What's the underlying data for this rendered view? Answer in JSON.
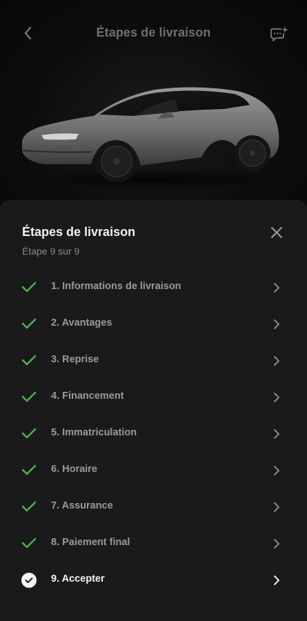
{
  "header": {
    "title": "Étapes de livraison"
  },
  "sheet": {
    "title": "Étapes de livraison",
    "subtitle": "Étape 9 sur 9"
  },
  "steps": [
    {
      "label": "1. Informations de livraison",
      "status": "complete"
    },
    {
      "label": "2. Avantages",
      "status": "complete"
    },
    {
      "label": "3. Reprise",
      "status": "complete"
    },
    {
      "label": "4. Financement",
      "status": "complete"
    },
    {
      "label": "5. Immatriculation",
      "status": "complete"
    },
    {
      "label": "6. Horaire",
      "status": "complete"
    },
    {
      "label": "7. Assurance",
      "status": "complete"
    },
    {
      "label": "8. Paiement final",
      "status": "complete"
    },
    {
      "label": "9. Accepter",
      "status": "current"
    }
  ],
  "icons": {
    "back": "chevron-left-icon",
    "chat": "chat-sparkle-icon",
    "close": "close-icon",
    "complete": "checkmark-icon",
    "current": "check-circle-icon",
    "row": "chevron-right-icon"
  },
  "colors": {
    "check_green": "#4caf50",
    "sheet_bg": "#1a1a1a",
    "text_muted": "#9a9a9a"
  }
}
